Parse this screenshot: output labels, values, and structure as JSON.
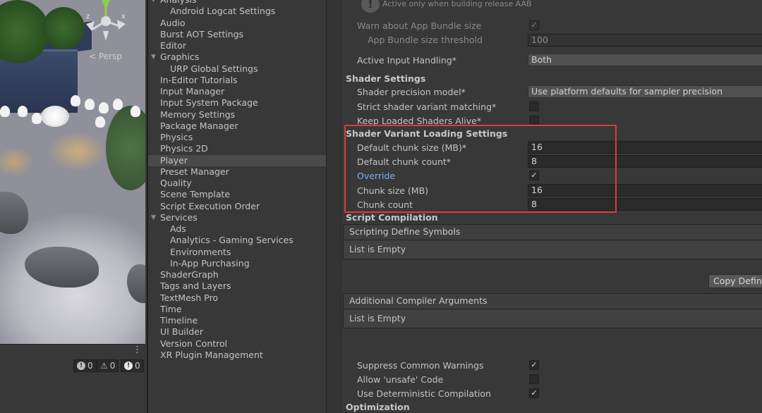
{
  "scene": {
    "persp_label": "< Persp",
    "axis_labels": {
      "x": "x",
      "z": "z"
    },
    "console": {
      "log_count": "0",
      "warning_count": "0",
      "error_count": "0"
    },
    "more_menu": "⋮"
  },
  "categories": [
    {
      "label": "Analysis",
      "indent": 0,
      "fold": true,
      "selected": false
    },
    {
      "label": "Android Logcat Settings",
      "indent": 1,
      "fold": false,
      "selected": false
    },
    {
      "label": "Audio",
      "indent": 0,
      "fold": false,
      "selected": false
    },
    {
      "label": "Burst AOT Settings",
      "indent": 0,
      "fold": false,
      "selected": false
    },
    {
      "label": "Editor",
      "indent": 0,
      "fold": false,
      "selected": false
    },
    {
      "label": "Graphics",
      "indent": 0,
      "fold": true,
      "selected": false
    },
    {
      "label": "URP Global Settings",
      "indent": 1,
      "fold": false,
      "selected": false
    },
    {
      "label": "In-Editor Tutorials",
      "indent": 0,
      "fold": false,
      "selected": false
    },
    {
      "label": "Input Manager",
      "indent": 0,
      "fold": false,
      "selected": false
    },
    {
      "label": "Input System Package",
      "indent": 0,
      "fold": false,
      "selected": false
    },
    {
      "label": "Memory Settings",
      "indent": 0,
      "fold": false,
      "selected": false
    },
    {
      "label": "Package Manager",
      "indent": 0,
      "fold": false,
      "selected": false
    },
    {
      "label": "Physics",
      "indent": 0,
      "fold": false,
      "selected": false
    },
    {
      "label": "Physics 2D",
      "indent": 0,
      "fold": false,
      "selected": false
    },
    {
      "label": "Player",
      "indent": 0,
      "fold": false,
      "selected": true
    },
    {
      "label": "Preset Manager",
      "indent": 0,
      "fold": false,
      "selected": false
    },
    {
      "label": "Quality",
      "indent": 0,
      "fold": false,
      "selected": false
    },
    {
      "label": "Scene Template",
      "indent": 0,
      "fold": false,
      "selected": false
    },
    {
      "label": "Script Execution Order",
      "indent": 0,
      "fold": false,
      "selected": false
    },
    {
      "label": "Services",
      "indent": 0,
      "fold": true,
      "selected": false
    },
    {
      "label": "Ads",
      "indent": 1,
      "fold": false,
      "selected": false
    },
    {
      "label": "Analytics - Gaming Services",
      "indent": 1,
      "fold": false,
      "selected": false
    },
    {
      "label": "Environments",
      "indent": 1,
      "fold": false,
      "selected": false
    },
    {
      "label": "In-App Purchasing",
      "indent": 1,
      "fold": false,
      "selected": false
    },
    {
      "label": "ShaderGraph",
      "indent": 0,
      "fold": false,
      "selected": false
    },
    {
      "label": "Tags and Layers",
      "indent": 0,
      "fold": false,
      "selected": false
    },
    {
      "label": "TextMesh Pro",
      "indent": 0,
      "fold": false,
      "selected": false
    },
    {
      "label": "Time",
      "indent": 0,
      "fold": false,
      "selected": false
    },
    {
      "label": "Timeline",
      "indent": 0,
      "fold": false,
      "selected": false
    },
    {
      "label": "UI Builder",
      "indent": 0,
      "fold": false,
      "selected": false
    },
    {
      "label": "Version Control",
      "indent": 0,
      "fold": false,
      "selected": false
    },
    {
      "label": "XR Plugin Management",
      "indent": 0,
      "fold": false,
      "selected": false
    }
  ],
  "inspector": {
    "help_text": "Active only when building release AAB",
    "help_icon": "!",
    "warn_app_bundle": {
      "label": "Warn about App Bundle size",
      "checked": "✓"
    },
    "app_bundle_threshold": {
      "label": "App Bundle size threshold",
      "value": "100"
    },
    "active_input": {
      "label": "Active Input Handling*",
      "value": "Both"
    },
    "shader_settings": {
      "header": "Shader Settings",
      "precision": {
        "label": "Shader precision model*",
        "value": "Use platform defaults for sampler precision"
      },
      "strict_matching": {
        "label": "Strict shader variant matching*",
        "checked": ""
      },
      "keep_loaded": {
        "label": "Keep Loaded Shaders Alive*",
        "checked": ""
      }
    },
    "variant_loading": {
      "header": "Shader Variant Loading Settings",
      "default_chunk_size": {
        "label": "Default chunk size (MB)*",
        "value": "16"
      },
      "default_chunk_count": {
        "label": "Default chunk count*",
        "value": "8"
      },
      "override": {
        "label": "Override",
        "checked": "✓"
      },
      "chunk_size": {
        "label": "Chunk size (MB)",
        "value": "16"
      },
      "chunk_count": {
        "label": "Chunk count",
        "value": "8"
      }
    },
    "script_compilation": {
      "header": "Script Compilation",
      "define_symbols": {
        "header": "Scripting Define Symbols",
        "body": "List is Empty"
      },
      "copy_defines_button": "Copy Defines",
      "compiler_args": {
        "header": "Additional Compiler Arguments",
        "body": "List is Empty"
      },
      "suppress_warnings": {
        "label": "Suppress Common Warnings",
        "checked": "✓"
      },
      "allow_unsafe": {
        "label": "Allow 'unsafe' Code",
        "checked": ""
      },
      "deterministic": {
        "label": "Use Deterministic Compilation",
        "checked": "✓"
      }
    },
    "optimization_header": "Optimization"
  },
  "colors": {
    "highlight_box": "#e03a3a",
    "override_label": "#7ab0f0",
    "selected_row": "#4a4a4a"
  }
}
